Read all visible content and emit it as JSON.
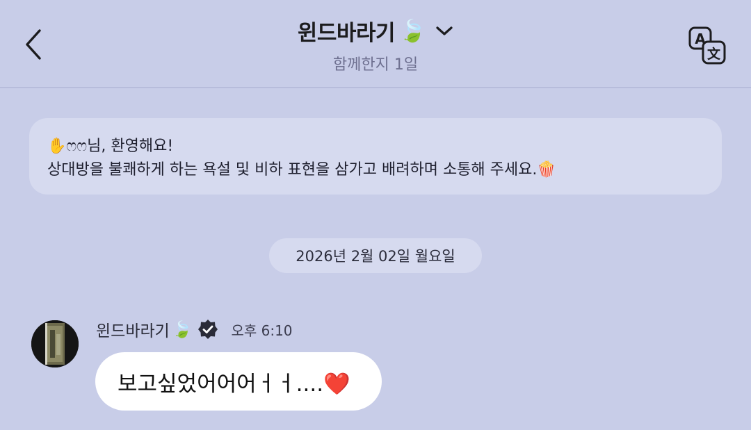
{
  "header": {
    "title": "윈드바라기",
    "title_emoji": "🍃",
    "subtitle": "함께한지 1일"
  },
  "notice": {
    "line1": "✋ෆෆ님, 환영해요!",
    "line2": "상대방을 불쾌하게 하는 욕설 및 비하 표현을 삼가고 배려하며 소통해 주세요.🍿"
  },
  "date_separator": "2026년 2월 02일 월요일",
  "message": {
    "sender": "윈드바라기",
    "sender_emoji": "🍃",
    "time": "오후 6:10",
    "text": "보고싶었어어어ㅓㅓ....❤️"
  },
  "icons": {
    "back": "chevron-left-icon",
    "dropdown": "chevron-down-icon",
    "translate": "translate-icon",
    "verified": "verified-badge-icon"
  },
  "colors": {
    "background": "#c8cde8",
    "panel": "#d6daef",
    "bubble": "#ffffff"
  }
}
